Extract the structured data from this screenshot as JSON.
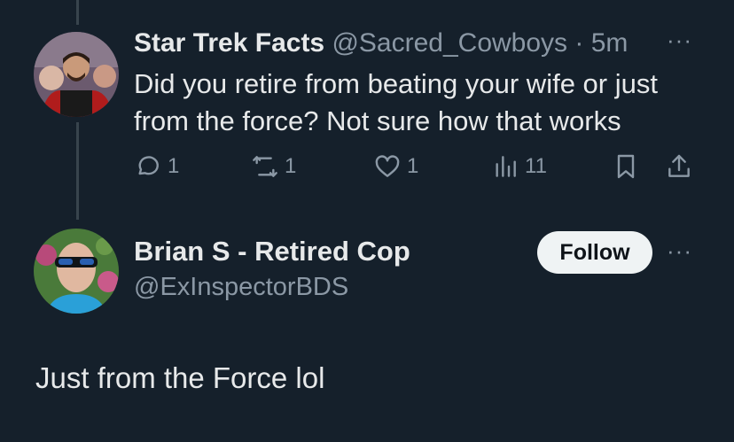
{
  "reply": {
    "name": "Star Trek Facts",
    "handle": "@Sacred_Cowboys",
    "separator": " · ",
    "time": "5m",
    "text": "Did you retire from beating your wife or just from the force? Not sure how that works",
    "more": "···",
    "actions": {
      "replies": "1",
      "retweets": "1",
      "likes": "1",
      "views": "11"
    }
  },
  "main_post": {
    "name": "Brian S - Retired Cop",
    "handle": "@ExInspectorBDS",
    "follow_label": "Follow",
    "more": "···",
    "text": "Just from the Force lol"
  }
}
